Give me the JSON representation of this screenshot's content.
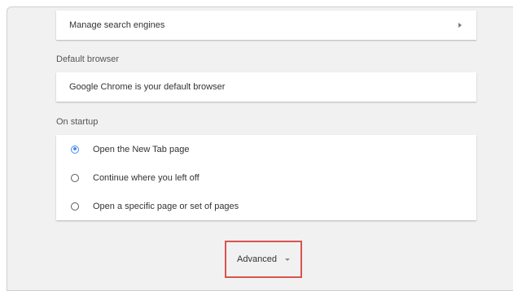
{
  "search": {
    "manage_label": "Manage search engines"
  },
  "default_browser": {
    "heading": "Default browser",
    "status": "Google Chrome is your default browser"
  },
  "on_startup": {
    "heading": "On startup",
    "options": [
      {
        "label": "Open the New Tab page",
        "selected": true
      },
      {
        "label": "Continue where you left off",
        "selected": false
      },
      {
        "label": "Open a specific page or set of pages",
        "selected": false
      }
    ]
  },
  "advanced": {
    "label": "Advanced"
  },
  "colors": {
    "accent": "#4a89f3",
    "highlight": "#d9534f",
    "background": "#f1f1f1"
  }
}
